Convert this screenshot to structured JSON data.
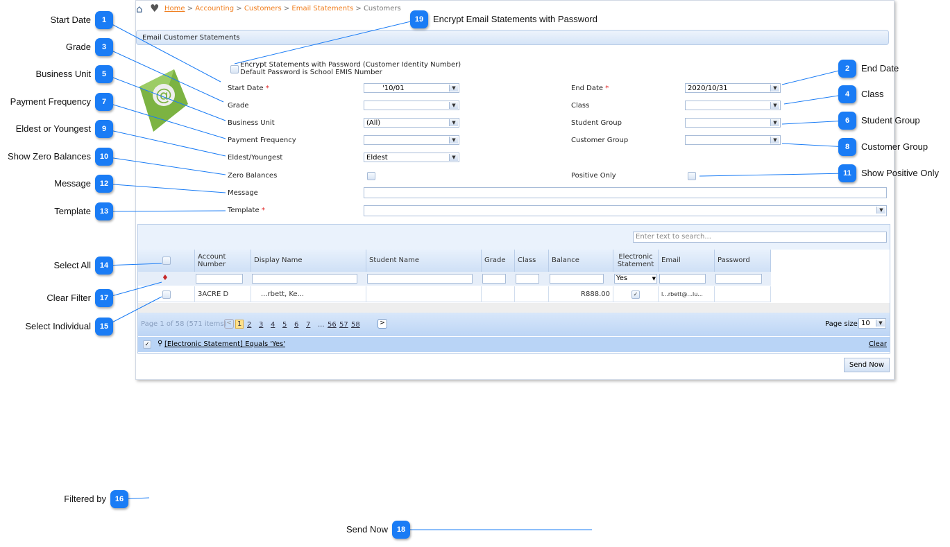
{
  "breadcrumb": {
    "home": "Home",
    "items": [
      "Accounting",
      "Customers",
      "Email Statements"
    ],
    "current": "Customers"
  },
  "panel_title": "Email Customer Statements",
  "encrypt": {
    "line1": "Encrypt Statements with Password (Customer Identity Number)",
    "line2": "Default Password is School EMIS Number",
    "checked": false
  },
  "form": {
    "start_date": {
      "label": "Start Date",
      "value": "'10/01"
    },
    "end_date": {
      "label": "End Date",
      "value": "2020/10/31"
    },
    "grade": {
      "label": "Grade",
      "value": ""
    },
    "class": {
      "label": "Class",
      "value": ""
    },
    "business_unit": {
      "label": "Business Unit",
      "value": "(All)"
    },
    "student_group": {
      "label": "Student Group",
      "value": ""
    },
    "payment_frequency": {
      "label": "Payment Frequency",
      "value": ""
    },
    "customer_group": {
      "label": "Customer Group",
      "value": ""
    },
    "eldest_youngest": {
      "label": "Eldest/Youngest",
      "value": "Eldest"
    },
    "zero_balances": {
      "label": "Zero Balances",
      "checked": false
    },
    "positive_only": {
      "label": "Positive Only",
      "checked": false
    },
    "message": {
      "label": "Message",
      "value": ""
    },
    "template": {
      "label": "Template",
      "value": ""
    },
    "required_mark": "*"
  },
  "grid": {
    "search_placeholder": "Enter text to search...",
    "columns": [
      "Account Number",
      "Display Name",
      "Student Name",
      "Grade",
      "Class",
      "Balance",
      "Electronic Statement",
      "Email",
      "Password"
    ],
    "filter_electronic": "Yes",
    "rows": [
      {
        "account": "3ACRE D",
        "display": "...rbett, Ke...",
        "student": "",
        "grade": "",
        "class": "",
        "balance": "R888.00",
        "electronic": true,
        "email": "l...rbett@...lu...",
        "password": ""
      }
    ],
    "pager": {
      "summary": "Page 1 of 58 (571 items)",
      "pages": [
        "1",
        "2",
        "3",
        "4",
        "5",
        "6",
        "7",
        "...",
        "56",
        "57",
        "58"
      ],
      "current": "1",
      "page_size_label": "Page size:",
      "page_size": "10"
    },
    "filter_expr": "[Electronic Statement] Equals 'Yes'",
    "clear_label": "Clear"
  },
  "send_now": "Send Now",
  "callouts": [
    {
      "n": "1",
      "label": "Start Date"
    },
    {
      "n": "2",
      "label": "End Date"
    },
    {
      "n": "3",
      "label": "Grade"
    },
    {
      "n": "4",
      "label": "Class"
    },
    {
      "n": "5",
      "label": "Business Unit"
    },
    {
      "n": "6",
      "label": "Student Group"
    },
    {
      "n": "7",
      "label": "Payment Frequency"
    },
    {
      "n": "8",
      "label": "Customer Group"
    },
    {
      "n": "9",
      "label": "Eldest or Youngest"
    },
    {
      "n": "10",
      "label": "Show Zero Balances"
    },
    {
      "n": "11",
      "label": "Show Positive Only"
    },
    {
      "n": "12",
      "label": "Message"
    },
    {
      "n": "13",
      "label": "Template"
    },
    {
      "n": "14",
      "label": "Select All"
    },
    {
      "n": "15",
      "label": "Select Individual"
    },
    {
      "n": "16",
      "label": "Filtered by"
    },
    {
      "n": "17",
      "label": "Clear Filter"
    },
    {
      "n": "18",
      "label": "Send Now"
    },
    {
      "n": "19",
      "label": "Encrypt Email Statements with Password"
    }
  ],
  "colors": {
    "accent": "#1a7cf5",
    "link": "#f07e1e",
    "header": "#d5e4f7"
  }
}
